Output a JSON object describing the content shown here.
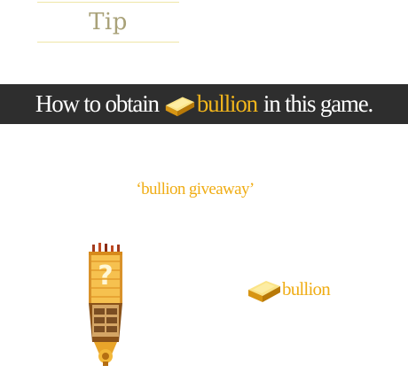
{
  "tip": {
    "label": "Tip"
  },
  "banner": {
    "prefix": "How to obtain",
    "highlight": "bullion",
    "suffix": "in this game.",
    "icon": "gold-bar-icon"
  },
  "giveaway": {
    "text": "‘bullion giveaway’"
  },
  "reward": {
    "source_icon": "mystery-tower-icon",
    "item_icon": "gold-bar-icon",
    "item_label": "bullion"
  },
  "colors": {
    "banner_bg": "#2e2e2e",
    "gold_text": "#f0ad15",
    "tip_text": "#a9a279",
    "tip_lines": "#efe6a6"
  }
}
